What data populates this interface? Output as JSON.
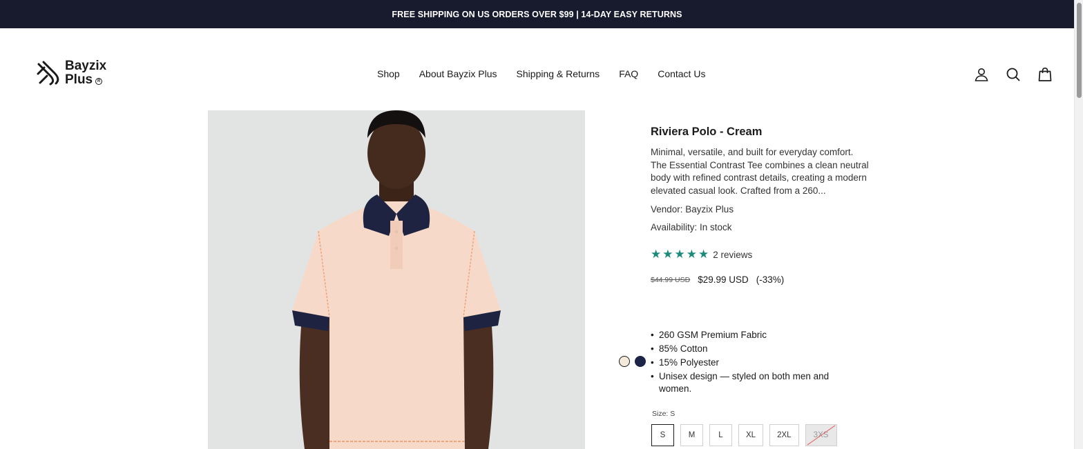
{
  "announcement": "FREE SHIPPING ON US ORDERS OVER $99 | 14-DAY EASY RETURNS",
  "logo": {
    "line1": "Bayzix",
    "line2": "Plus",
    "reg": "R"
  },
  "nav": [
    "Shop",
    "About Bayzix Plus",
    "Shipping & Returns",
    "FAQ",
    "Contact Us"
  ],
  "header_icons": [
    "account-icon",
    "search-icon",
    "cart-icon"
  ],
  "product": {
    "title": "Riviera Polo - Cream",
    "description": "Minimal, versatile, and built for everyday comfort. The Essential Contrast Tee combines a clean neutral body with refined contrast details, creating a modern elevated casual look. Crafted from a 260...",
    "vendor": "Vendor: Bayzix Plus",
    "availability": "Availability: In stock",
    "rating": {
      "stars": 5,
      "reviews_label": "2 reviews"
    },
    "price": {
      "old": "$44.99 USD",
      "new": "$29.99 USD",
      "discount": "(-33%)"
    },
    "features": [
      "260 GSM Premium Fabric",
      "85% Cotton",
      "15% Polyester",
      "Unisex design — styled on both men and women."
    ],
    "swatches": [
      {
        "name": "cream",
        "color": "#f3ead9"
      },
      {
        "name": "navy",
        "color": "#1c2447"
      }
    ],
    "size_label": "Size: S",
    "sizes": [
      "S",
      "M",
      "L",
      "XL",
      "2XL",
      "3XS"
    ],
    "selected_size": "S",
    "unavailable_size": "3XS"
  },
  "colors": {
    "announcement_bg": "#181a2e",
    "star": "#1c8a78"
  }
}
